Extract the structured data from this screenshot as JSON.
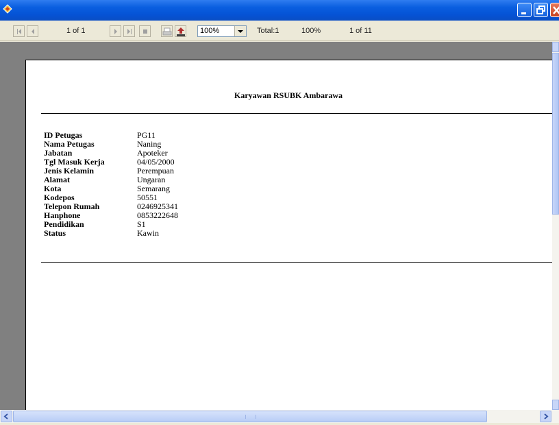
{
  "window": {
    "title": ""
  },
  "toolbar": {
    "page_indicator": "1 of 1",
    "zoom": "100%",
    "total": "Total:1",
    "percent": "100%",
    "record_indicator": "1 of 11"
  },
  "report": {
    "title": "Karyawan RSUBK Ambarawa",
    "fields": [
      {
        "label": "ID Petugas",
        "value": "PG11"
      },
      {
        "label": "Nama Petugas",
        "value": "Naning"
      },
      {
        "label": "Jabatan",
        "value": "Apoteker"
      },
      {
        "label": "Tgl Masuk Kerja",
        "value": "04/05/2000"
      },
      {
        "label": "Jenis Kelamin",
        "value": "Perempuan"
      },
      {
        "label": "Alamat",
        "value": "Ungaran"
      },
      {
        "label": "Kota",
        "value": "Semarang"
      },
      {
        "label": "Kodepos",
        "value": "50551"
      },
      {
        "label": "Telepon Rumah",
        "value": "0246925341"
      },
      {
        "label": "Hanphone",
        "value": "0853222648"
      },
      {
        "label": "Pendidikan",
        "value": "S1"
      },
      {
        "label": "Status",
        "value": "Kawin"
      }
    ]
  },
  "icons": {
    "first": "first-page-icon",
    "prev": "previous-page-icon",
    "next": "next-page-icon",
    "last": "last-page-icon",
    "stop": "stop-icon",
    "print": "print-icon",
    "export": "export-icon",
    "minimize": "minimize-icon",
    "restore": "restore-icon",
    "close": "close-icon"
  }
}
